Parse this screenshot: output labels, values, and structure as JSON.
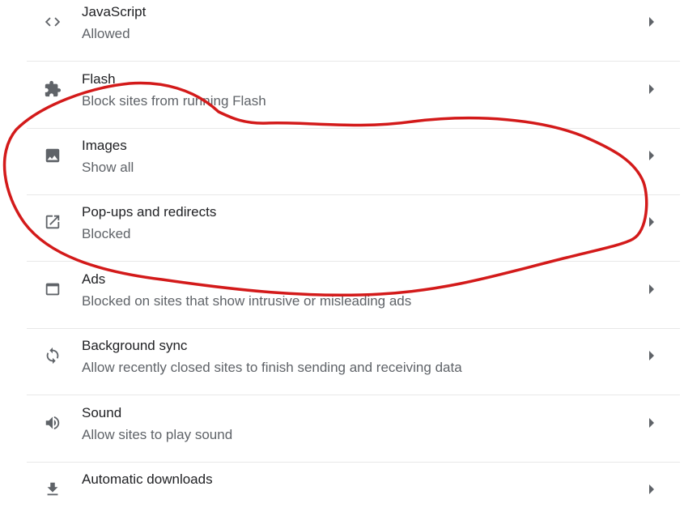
{
  "settings": {
    "items": [
      {
        "title": "JavaScript",
        "subtitle": "Allowed",
        "icon": "code-icon"
      },
      {
        "title": "Flash",
        "subtitle": "Block sites from running Flash",
        "icon": "puzzle-icon"
      },
      {
        "title": "Images",
        "subtitle": "Show all",
        "icon": "image-icon"
      },
      {
        "title": "Pop-ups and redirects",
        "subtitle": "Blocked",
        "icon": "open-in-new-icon"
      },
      {
        "title": "Ads",
        "subtitle": "Blocked on sites that show intrusive or misleading ads",
        "icon": "web-asset-icon"
      },
      {
        "title": "Background sync",
        "subtitle": "Allow recently closed sites to finish sending and receiving data",
        "icon": "sync-icon"
      },
      {
        "title": "Sound",
        "subtitle": "Allow sites to play sound",
        "icon": "volume-icon"
      },
      {
        "title": "Automatic downloads",
        "subtitle": "",
        "icon": "download-icon"
      }
    ]
  },
  "colors": {
    "title_text": "#202124",
    "subtitle_text": "#5f6368",
    "icon": "#5f6368",
    "divider": "#e8e8e8",
    "annotation": "#d31a1a"
  }
}
